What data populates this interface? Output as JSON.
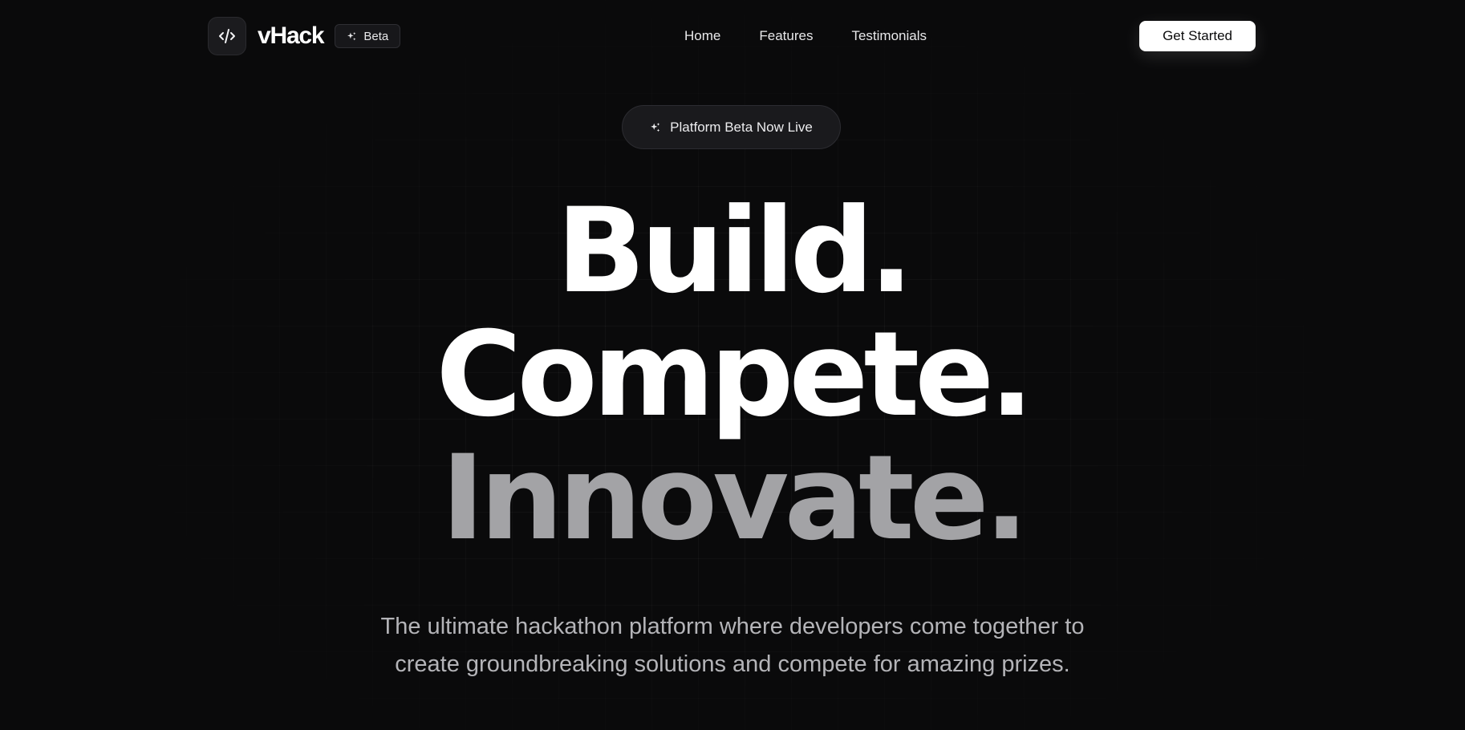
{
  "nav": {
    "brand": "vHack",
    "logo_icon": "code-icon",
    "badge": {
      "icon": "sparkles-icon",
      "label": "Beta"
    },
    "links": [
      "Home",
      "Features",
      "Testimonials"
    ],
    "cta_label": "Get Started"
  },
  "hero": {
    "announcement": {
      "icon": "sparkles-icon",
      "label": "Platform Beta Now Live"
    },
    "headline": [
      "Build.",
      "Compete.",
      "Innovate."
    ],
    "subtitle": "The ultimate hackathon platform where developers come together to create groundbreaking solutions and compete for amazing prizes."
  },
  "colors": {
    "background": "#0a0a0b",
    "text_primary": "#ffffff",
    "text_muted": "#a3a3a6",
    "cta_background": "#ffffff"
  }
}
